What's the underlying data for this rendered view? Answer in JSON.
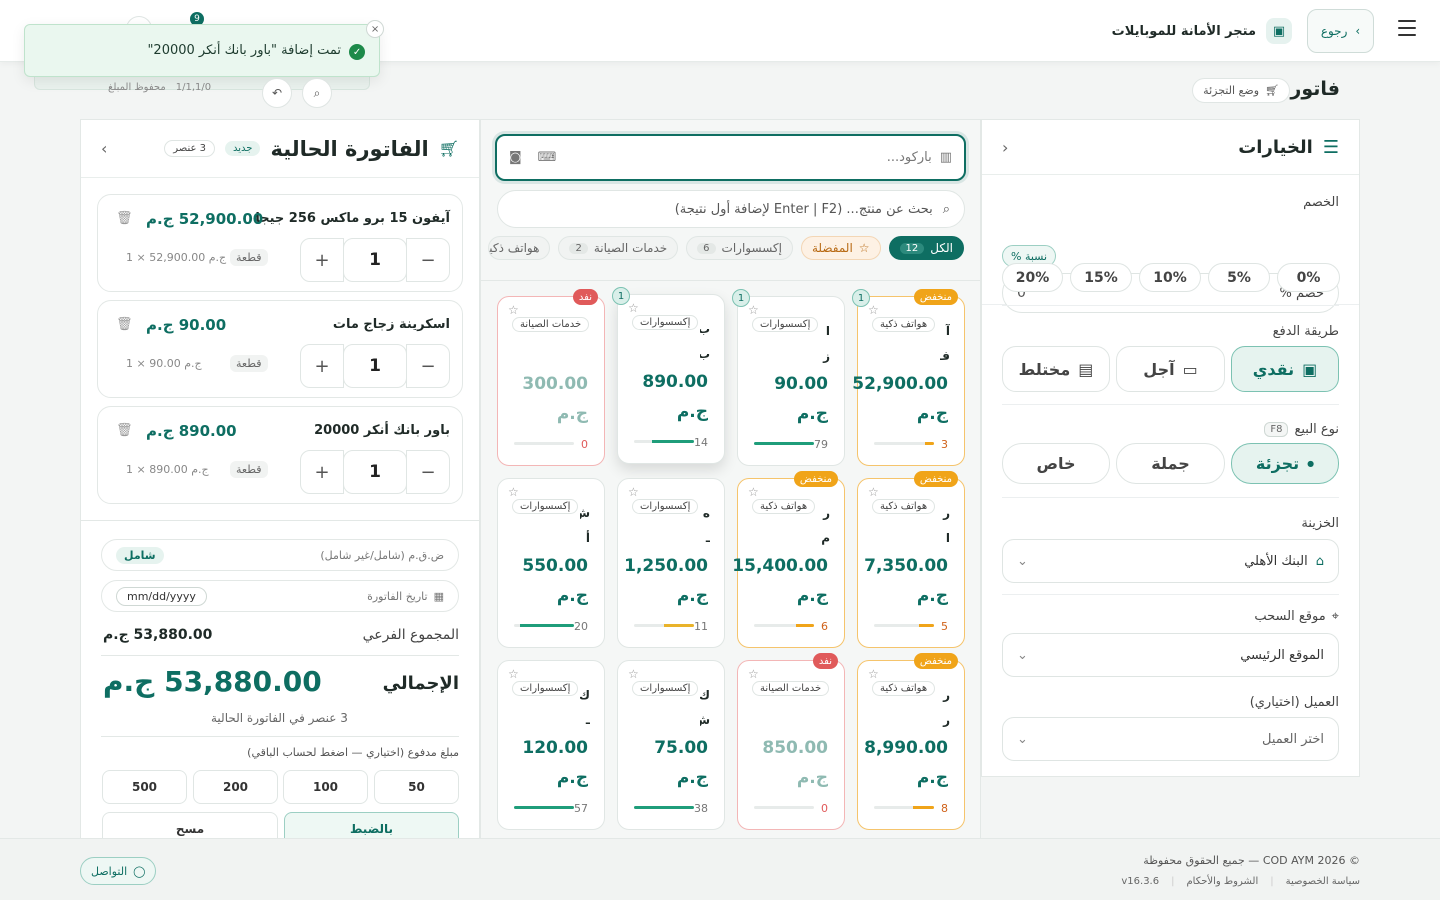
{
  "header": {
    "back_label": "رجوع",
    "store_name": "متجر الأمانة للموبايلات",
    "notif_count": "9"
  },
  "toast": {
    "message": "تمت إضافة \"باور بانك أنكر 20000\""
  },
  "page": {
    "title": "فاتورة",
    "mode_label": "وضع التجزئة",
    "sub_left": "محفوظ المبلغ",
    "sub_left_count": "1/1,1/0"
  },
  "options": {
    "title": "الخيارات",
    "discount_label": "الخصم",
    "discount_type": "نسبة %",
    "discount_field_label": "خصم %",
    "discount_value": "0",
    "discount_chips": [
      "0%",
      "5%",
      "10%",
      "15%",
      "20%"
    ],
    "payment_label": "طريقة الدفع",
    "payment_methods": [
      "نقدي",
      "آجل",
      "مختلط"
    ],
    "sale_type_label": "نوع البيع",
    "sale_type_key": "F8",
    "sale_types": [
      "تجزئة",
      "جملة",
      "خاص"
    ],
    "treasury_label": "الخزينة",
    "treasury_value": "البنك الأهلي",
    "pickup_label": "موقع السحب",
    "pickup_value": "الموقع الرئيسي",
    "customer_label": "العميل (اختياري)",
    "customer_placeholder": "اختر العميل"
  },
  "center": {
    "barcode_placeholder": "باركود...",
    "search_placeholder": "بحث عن منتج... (Enter | F2 لإضافة أول نتيجة)",
    "categories": [
      {
        "label": "الكل",
        "count": "12"
      },
      {
        "label": "المفضلة",
        "count": ""
      },
      {
        "label": "إكسسوارات",
        "count": "6"
      },
      {
        "label": "خدمات الصيانة",
        "count": "2"
      },
      {
        "label": "هواتف ذكية",
        "count": ""
      }
    ],
    "products": [
      {
        "name": "آ ف",
        "category": "هواتف ذكية",
        "price": "52,900.00",
        "currency": "ج.م",
        "qty": "3",
        "tag": "منخفض",
        "badge": "1",
        "stock": 0.15
      },
      {
        "name": "ا ز",
        "category": "إكسسوارات",
        "price": "90.00",
        "currency": "ج.م",
        "qty": "79",
        "tag": "",
        "badge": "1",
        "stock": 1
      },
      {
        "name": "ب ب",
        "category": "إكسسوارات",
        "price": "890.00",
        "currency": "ج.م",
        "qty": "14",
        "tag": "",
        "badge": "1",
        "stock": 0.7
      },
      {
        "name": "",
        "category": "خدمات الصيانة",
        "price": "300.00",
        "currency": "ج.م",
        "qty": "0",
        "tag": "نفد",
        "badge": "",
        "stock": 0
      },
      {
        "name": "ر ا",
        "category": "هواتف ذكية",
        "price": "7,350.00",
        "currency": "ج.م",
        "qty": "5",
        "tag": "منخفض",
        "badge": "",
        "stock": 0.25
      },
      {
        "name": "ر م",
        "category": "هواتف ذكية",
        "price": "15,400.00",
        "currency": "ج.م",
        "qty": "6",
        "tag": "منخفض",
        "badge": "",
        "stock": 0.3
      },
      {
        "name": "ه ـ",
        "category": "إكسسوارات",
        "price": "1,250.00",
        "currency": "ج.م",
        "qty": "11",
        "tag": "",
        "badge": "",
        "stock": 0.5
      },
      {
        "name": "ش أ",
        "category": "إكسسوارات",
        "price": "550.00",
        "currency": "ج.م",
        "qty": "20",
        "tag": "",
        "badge": "",
        "stock": 0.9
      },
      {
        "name": "ر ر",
        "category": "هواتف ذكية",
        "price": "8,990.00",
        "currency": "ج.م",
        "qty": "8",
        "tag": "منخفض",
        "badge": "",
        "stock": 0.35
      },
      {
        "name": "",
        "category": "خدمات الصيانة",
        "price": "850.00",
        "currency": "ج.م",
        "qty": "0",
        "tag": "نفد",
        "badge": "",
        "stock": 0
      },
      {
        "name": "ك ش",
        "category": "إكسسوارات",
        "price": "75.00",
        "currency": "ج.م",
        "qty": "38",
        "tag": "",
        "badge": "",
        "stock": 1
      },
      {
        "name": "ك ـ",
        "category": "إكسسوارات",
        "price": "120.00",
        "currency": "ج.م",
        "qty": "57",
        "tag": "",
        "badge": "",
        "stock": 1
      }
    ]
  },
  "invoice": {
    "title": "الفاتورة الحالية",
    "new_badge": "جديد",
    "count_badge": "3 عنصر",
    "unit_label": "قطعة",
    "items": [
      {
        "name": "آيفون 15 برو ماكس 256 جيجا",
        "price": "52,900.00 ج.م",
        "qty": "1",
        "sub": "ج.م 52,900.00 × 1"
      },
      {
        "name": "اسكرينة زجاج مات",
        "price": "90.00 ج.م",
        "qty": "1",
        "sub": "ج.م 90.00 × 1"
      },
      {
        "name": "باور بانك أنكر 20000",
        "price": "890.00 ج.م",
        "qty": "1",
        "sub": "ج.م 890.00 × 1"
      }
    ],
    "vat_label": "ض.ق.م (شامل/غير شامل)",
    "vat_value": "شامل",
    "date_label": "تاريخ الفاتورة",
    "date_placeholder": "mm/dd/yyyy",
    "subtotal_label": "المجموع الفرعي",
    "subtotal_value": "53,880.00 ج.م",
    "total_label": "الإجمالي",
    "total_value": "53,880.00 ج.م",
    "total_note": "3 عنصر في الفاتورة الحالية",
    "paid_label": "مبلغ مدفوع (اختياري — اضغط لحساب الباقي)",
    "quick_amounts": [
      "50",
      "100",
      "200",
      "500"
    ],
    "exact_label": "بالضبط",
    "clear_label": "مسح"
  },
  "footer": {
    "copyright": "© 2026 COD AYM — جميع الحقوق محفوظة",
    "links": [
      "سياسة الخصوصية",
      "الشروط والأحكام",
      "v16.3.6"
    ],
    "contact_label": "التواصل"
  }
}
